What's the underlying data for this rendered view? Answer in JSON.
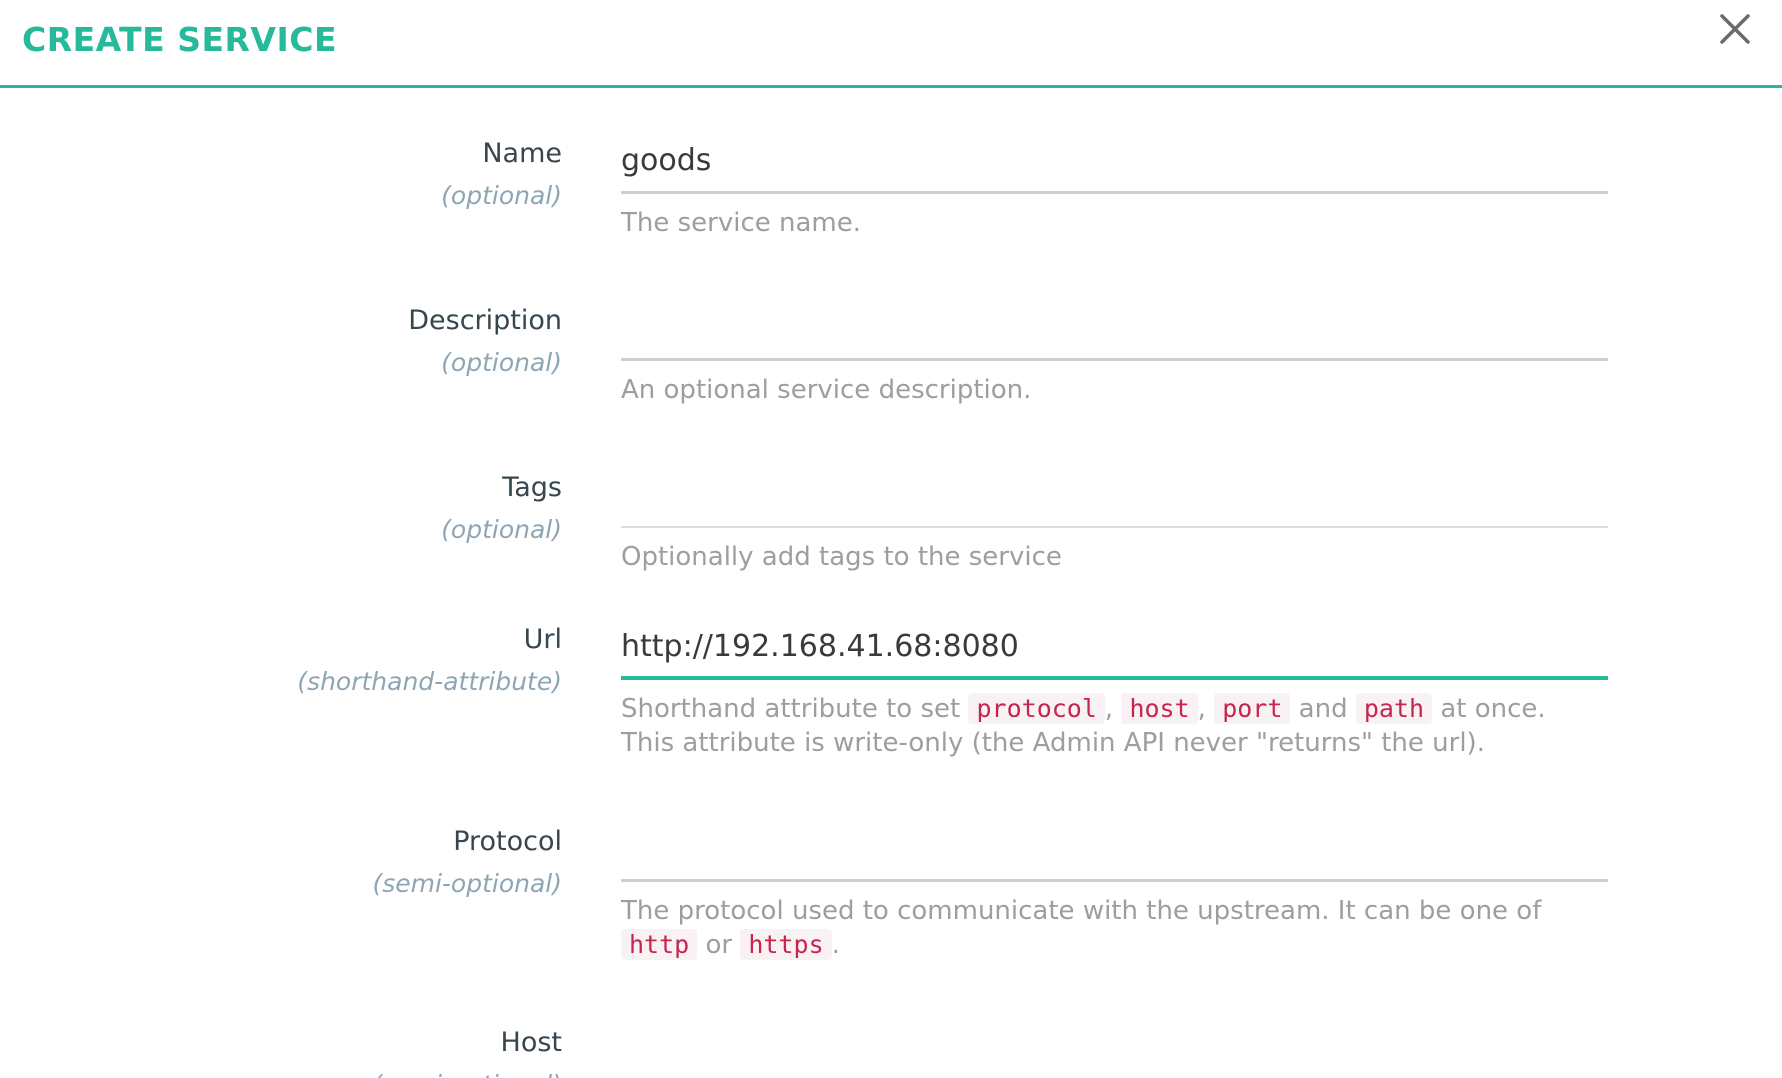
{
  "dialog": {
    "title": "CREATE SERVICE",
    "close_icon": "close-icon"
  },
  "accent_color": "#26b99a",
  "code_color": "#c7254e",
  "fields": {
    "name": {
      "label": "Name",
      "sublabel": "(optional)",
      "value": "goods",
      "help": "The service name."
    },
    "description": {
      "label": "Description",
      "sublabel": "(optional)",
      "value": "",
      "help": "An optional service description."
    },
    "tags": {
      "label": "Tags",
      "sublabel": "(optional)",
      "value": "",
      "help": "Optionally add tags to the service"
    },
    "url": {
      "label": "Url",
      "sublabel": "(shorthand-attribute)",
      "value": "http://192.168.41.68:8080",
      "help": {
        "prefix": "Shorthand attribute to set",
        "code_protocol": "protocol",
        "sep1": ",",
        "code_host": "host",
        "sep2": ",",
        "code_port": "port",
        "and": "and",
        "code_path": "path",
        "suffix": "at once.",
        "line2": "This attribute is write-only (the Admin API never \"returns\" the url)."
      }
    },
    "protocol": {
      "label": "Protocol",
      "sublabel": "(semi-optional)",
      "value": "",
      "help": {
        "prefix": "The protocol used to communicate with the upstream. It can be one of",
        "code_http": "http",
        "or": "or",
        "code_https": "https",
        "end": "."
      }
    },
    "host": {
      "label": "Host",
      "sublabel": "(semi-optional)"
    }
  }
}
